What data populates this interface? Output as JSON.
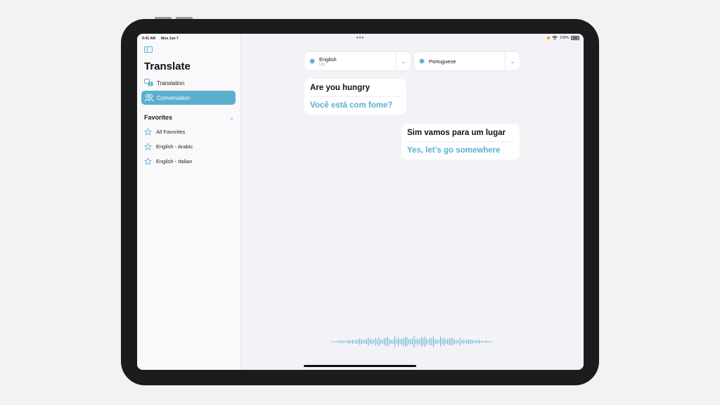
{
  "status_bar": {
    "time": "9:41 AM",
    "date": "Mon Jun 7",
    "battery": "100%"
  },
  "sidebar": {
    "title": "Translate",
    "nav": [
      {
        "label": "Translation",
        "icon": "translation-icon",
        "selected": false
      },
      {
        "label": "Conversation",
        "icon": "conversation-icon",
        "selected": true
      }
    ],
    "favorites_header": "Favorites",
    "favorites": [
      {
        "label": "All Favorites",
        "icon": "star-icon"
      },
      {
        "label": "English - Arabic",
        "icon": "star-icon"
      },
      {
        "label": "English - Italian",
        "icon": "star-icon"
      }
    ]
  },
  "language_selectors": {
    "source": {
      "name": "English",
      "region": "US"
    },
    "target": {
      "name": "Portuguese"
    }
  },
  "messages": [
    {
      "source": "Are you hungry",
      "translation": "Você está com fome?"
    },
    {
      "source": "Sim vamos para um lugar",
      "translation": "Yes, let's go somewhere"
    }
  ],
  "colors": {
    "accent": "#5aafcf",
    "background": "#f2f2f7",
    "device_frame": "#1c1c1e"
  }
}
